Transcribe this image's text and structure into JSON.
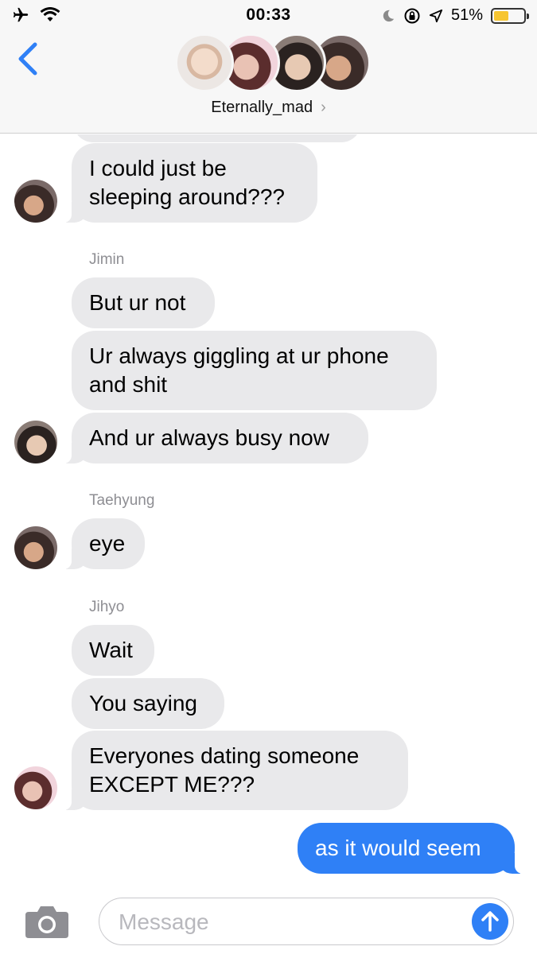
{
  "status_bar": {
    "time": "00:33",
    "battery_text": "51%",
    "battery_level": 0.51,
    "icons": [
      "airplane-icon",
      "wifi-icon",
      "moon-icon",
      "rotation-lock-icon",
      "location-arrow-icon",
      "battery-icon"
    ]
  },
  "header": {
    "group_name": "Eternally_mad",
    "chevron": "›",
    "avatars": [
      "avatar-1",
      "avatar-2",
      "avatar-3",
      "avatar-4"
    ]
  },
  "messages": {
    "m1": "I could just be sleeping around???",
    "sender_jimin": "Jimin",
    "m2": "But ur not",
    "m3": "Ur always giggling at ur phone and shit",
    "m4": "And ur always busy now",
    "sender_taehyung": "Taehyung",
    "m5": "eye",
    "sender_jihyo": "Jihyo",
    "m6": "Wait",
    "m7": "You saying",
    "m8": "Everyones dating someone EXCEPT ME???",
    "m9": "as it would seem"
  },
  "input": {
    "placeholder": "Message"
  },
  "colors": {
    "sent_bubble": "#2f80f6",
    "received_bubble": "#e9e9eb",
    "accent": "#2f80f6",
    "battery": "#f7c531"
  }
}
